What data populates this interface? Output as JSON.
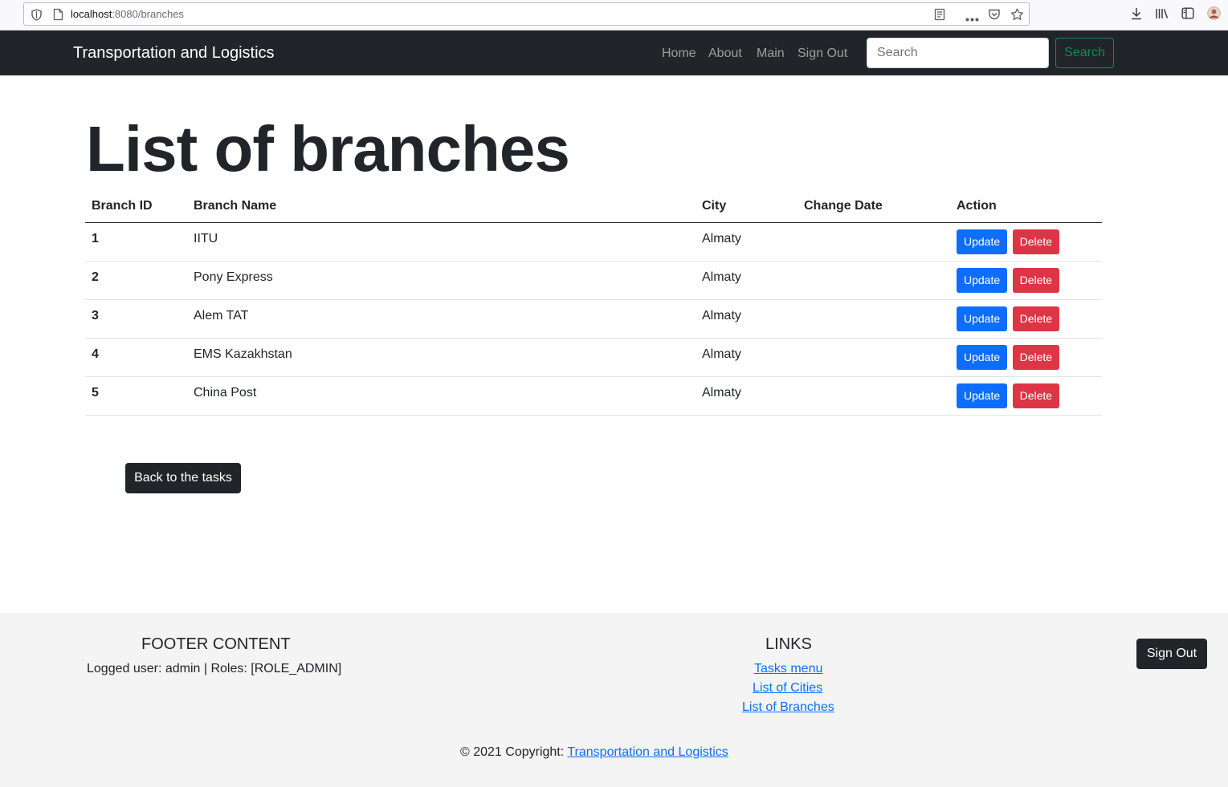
{
  "browser": {
    "url_host": "localhost",
    "url_path": ":8080/branches"
  },
  "navbar": {
    "brand": "Transportation and Logistics",
    "links": [
      "Home",
      "About",
      "Main",
      "Sign Out"
    ],
    "search_placeholder": "Search",
    "search_button": "Search"
  },
  "main": {
    "title": "List of branches",
    "table": {
      "headers": [
        "Branch ID",
        "Branch Name",
        "City",
        "Change Date",
        "Action"
      ],
      "rows": [
        {
          "id": "1",
          "name": "IITU",
          "city": "Almaty",
          "change_date": ""
        },
        {
          "id": "2",
          "name": "Pony Express",
          "city": "Almaty",
          "change_date": ""
        },
        {
          "id": "3",
          "name": "Alem TAT",
          "city": "Almaty",
          "change_date": ""
        },
        {
          "id": "4",
          "name": "EMS Kazakhstan",
          "city": "Almaty",
          "change_date": ""
        },
        {
          "id": "5",
          "name": "China Post",
          "city": "Almaty",
          "change_date": ""
        }
      ],
      "update_label": "Update",
      "delete_label": "Delete"
    },
    "back_button": "Back to the tasks"
  },
  "footer": {
    "content_heading": "Footer Content",
    "logged_user": "Logged user: admin | Roles: [ROLE_ADMIN]",
    "links_heading": "Links",
    "links": [
      "Tasks menu",
      "List of Cities",
      "List of Branches"
    ],
    "signout_button": "Sign Out",
    "copyright_prefix": "© 2021 Copyright: ",
    "copyright_link": "Transportation and Logistics"
  },
  "colors": {
    "navbar_bg": "#212529",
    "primary": "#0d6efd",
    "danger": "#dc3545",
    "success": "#198754",
    "footer_bg": "#f4f4f4"
  }
}
